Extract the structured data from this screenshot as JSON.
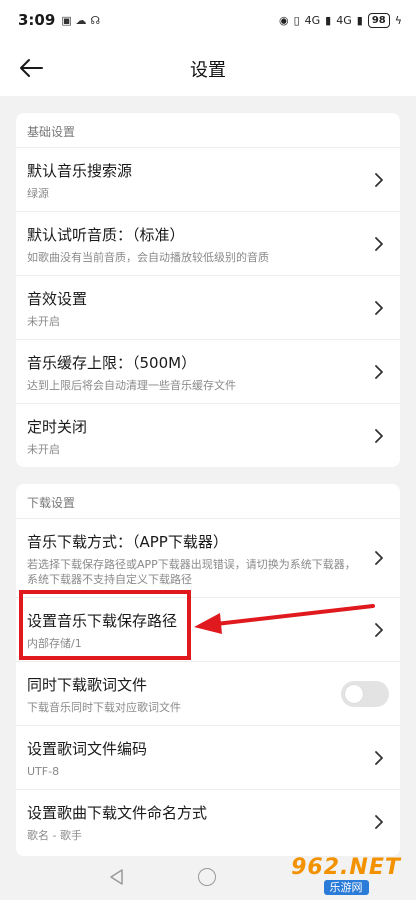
{
  "status_bar": {
    "time": "3:09",
    "network_badges": [
      "4G",
      "4G"
    ],
    "battery": "98"
  },
  "header": {
    "title": "设置",
    "back_icon": "arrow-left-icon"
  },
  "sections": [
    {
      "title": "基础设置",
      "items": [
        {
          "title": "默认音乐搜索源",
          "subtitle": "绿源"
        },
        {
          "title": "默认试听音质：（标准）",
          "subtitle": "如歌曲没有当前音质，会自动播放较低级别的音质"
        },
        {
          "title": "音效设置",
          "subtitle": "未开启"
        },
        {
          "title": "音乐缓存上限：（500M）",
          "subtitle": "达到上限后将会自动清理一些音乐缓存文件"
        },
        {
          "title": "定时关闭",
          "subtitle": "未开启"
        }
      ]
    },
    {
      "title": "下载设置",
      "items": [
        {
          "title": "音乐下载方式：（APP下载器）",
          "subtitle": "若选择下载保存路径或APP下载器出现错误，请切换为系统下载器，系统下载器不支持自定义下载路径"
        },
        {
          "title": "设置音乐下载保存路径",
          "subtitle": "内部存储/1"
        },
        {
          "title": "同时下载歌词文件",
          "subtitle": "下载音乐同时下载对应歌词文件",
          "toggle": false
        },
        {
          "title": "设置歌词文件编码",
          "subtitle": "UTF-8"
        },
        {
          "title": "设置歌曲下载文件命名方式",
          "subtitle": "歌名 - 歌手"
        }
      ]
    }
  ],
  "annotation": {
    "highlight_color": "#e0191e"
  },
  "watermark": {
    "main": "962.NET",
    "sub": "乐游网"
  },
  "colors": {
    "background": "#f2f2f2",
    "card": "#ffffff",
    "subtitle": "#8a8a8a"
  }
}
